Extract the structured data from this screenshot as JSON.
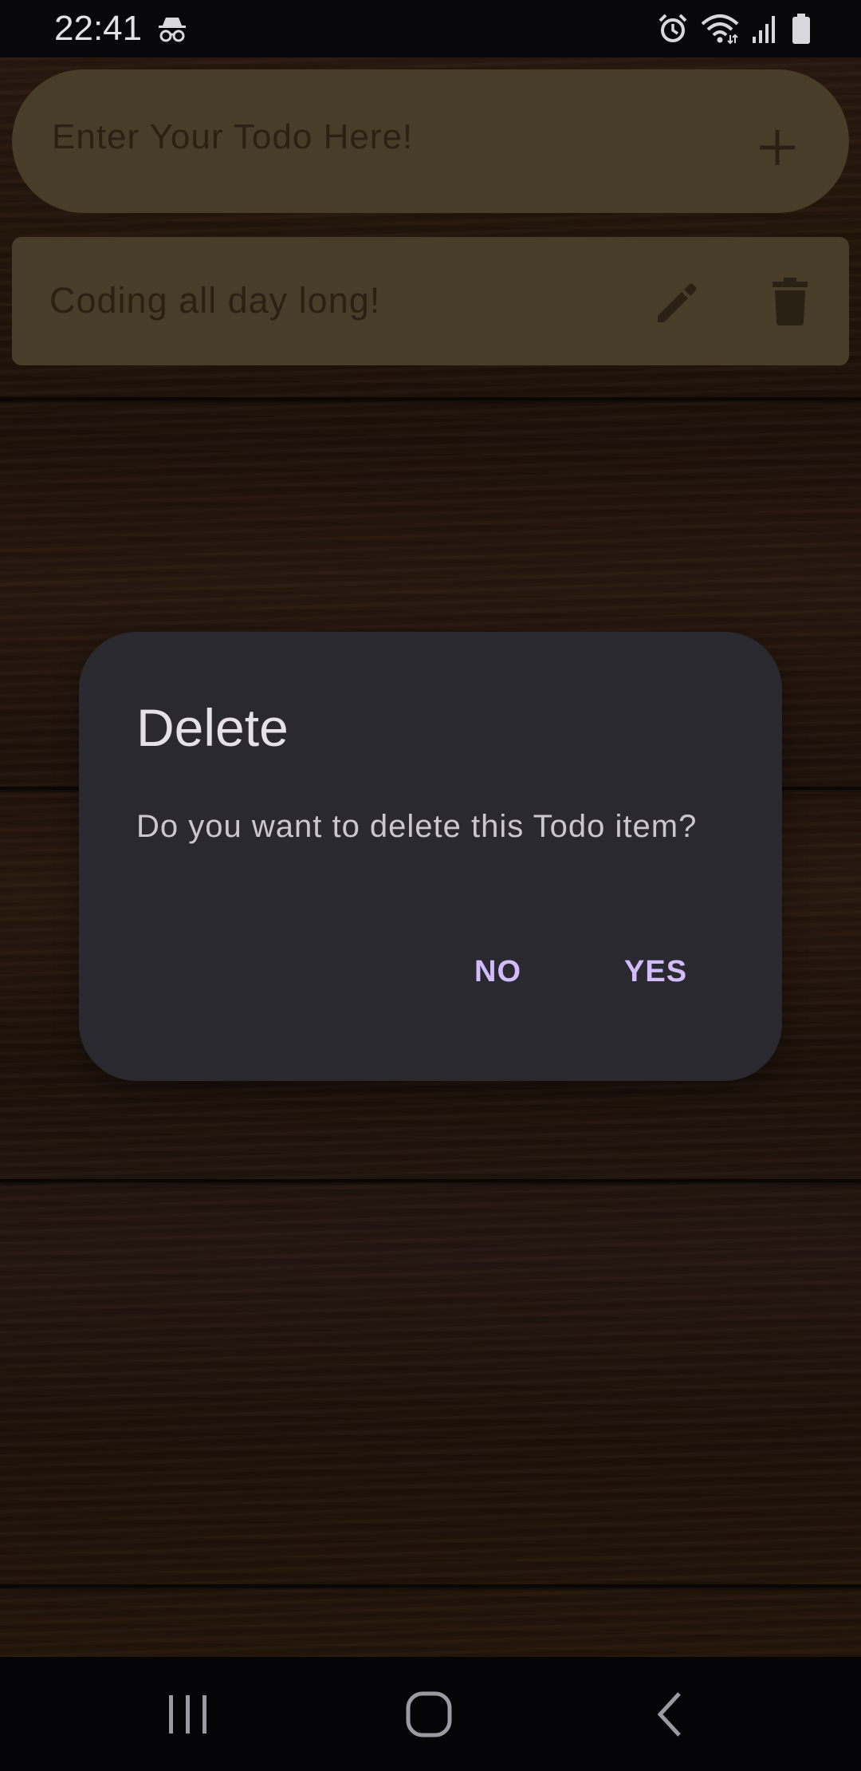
{
  "status_bar": {
    "time": "22:41",
    "icons": [
      "incognito-icon",
      "alarm-icon",
      "wifi-icon",
      "signal-icon",
      "battery-icon"
    ]
  },
  "todo_input": {
    "placeholder": "Enter Your Todo Here!",
    "add_icon": "plus-icon"
  },
  "todos": [
    {
      "text": "Coding all day long!",
      "edit_icon": "pencil-icon",
      "delete_icon": "trash-icon"
    }
  ],
  "dialog": {
    "title": "Delete",
    "message": "Do you want to delete this Todo item?",
    "no_label": "NO",
    "yes_label": "YES"
  },
  "nav_bar": {
    "icons": [
      "recents-icon",
      "home-icon",
      "back-icon"
    ]
  },
  "colors": {
    "dialog_bg": "#2a2930",
    "dialog_button": "#d2bcfc",
    "card_bg": "#6a5b3c",
    "card_text": "#3e321f",
    "status_bar_bg": "#08080b"
  }
}
